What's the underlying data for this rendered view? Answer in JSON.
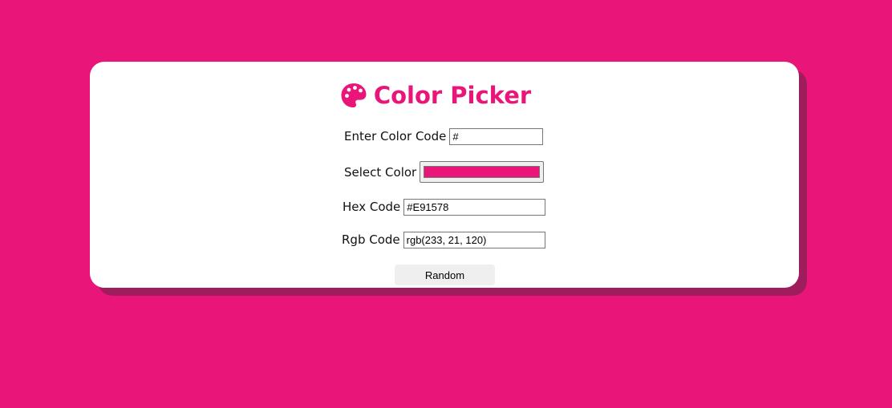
{
  "app": {
    "title": "Color Picker",
    "accent_color": "#E91578",
    "icon": "palette-icon"
  },
  "form": {
    "enter_code_label": "Enter Color Code",
    "enter_code_value": "#",
    "select_color_label": "Select Color",
    "selected_color": "#E91578",
    "hex_label": "Hex Code",
    "hex_value": "#E91578",
    "rgb_label": "Rgb Code",
    "rgb_value": "rgb(233, 21, 120)"
  },
  "actions": {
    "random_label": "Random"
  }
}
